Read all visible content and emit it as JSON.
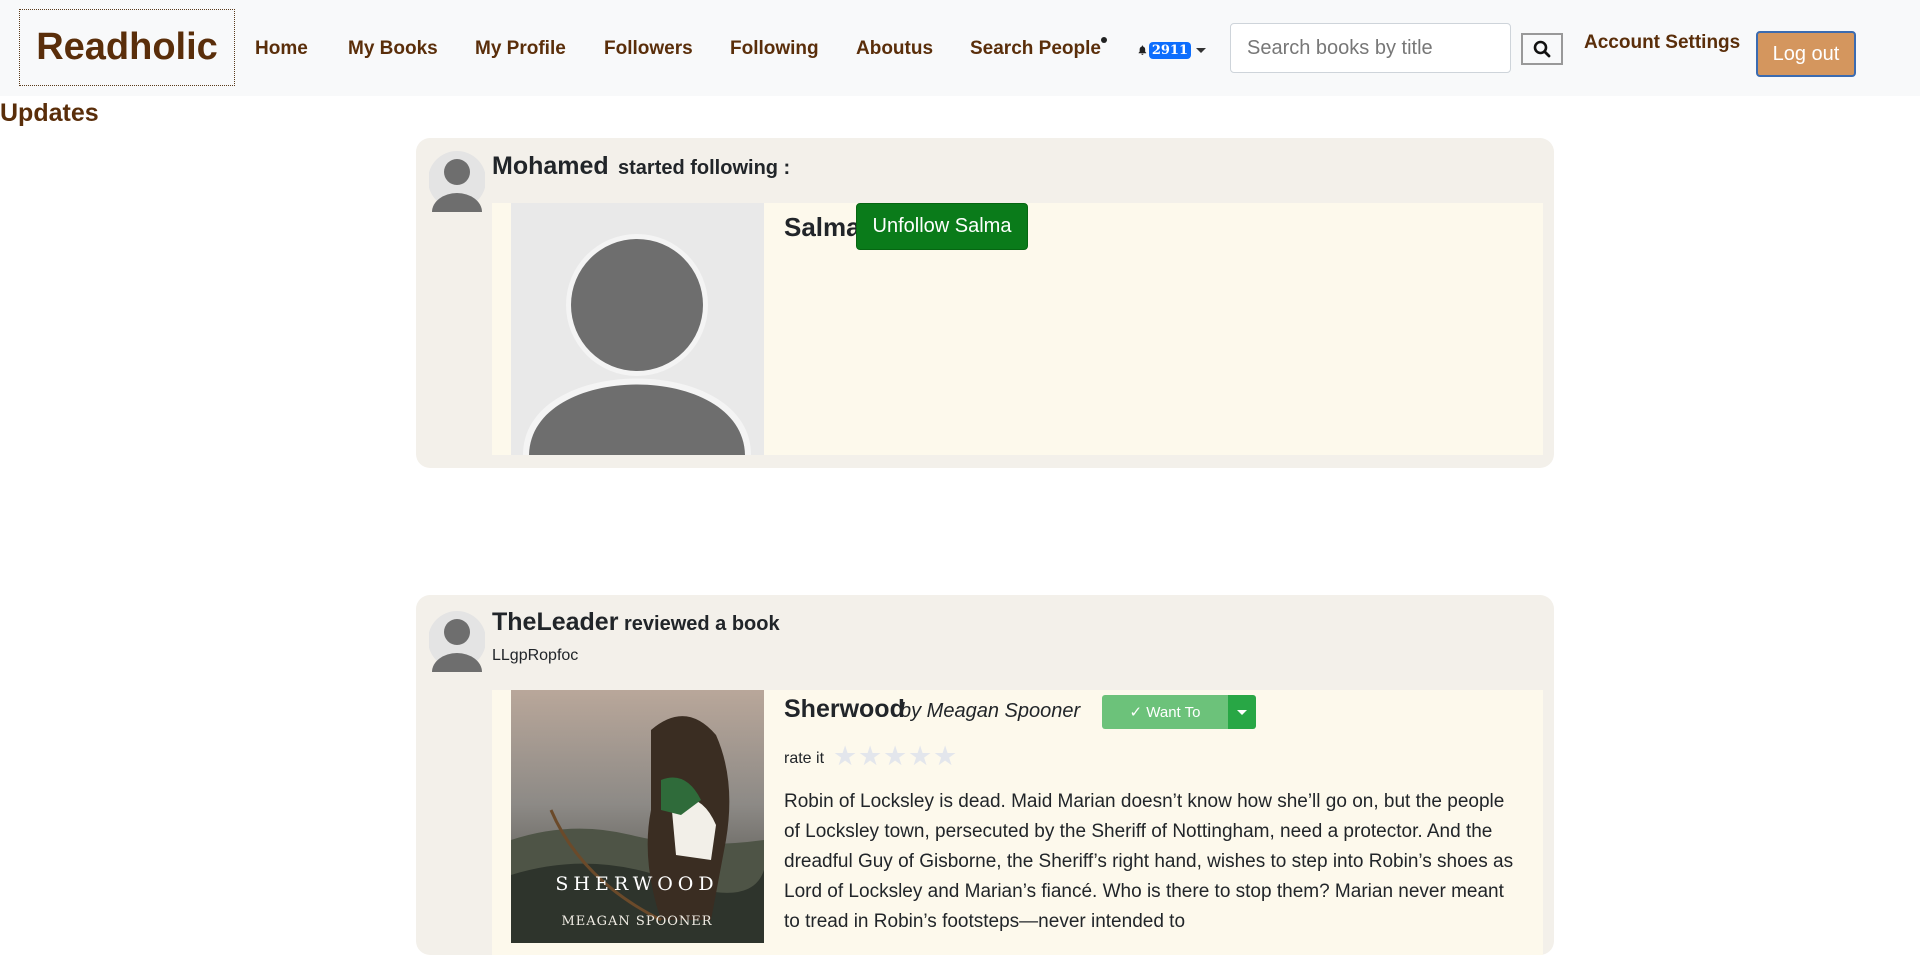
{
  "navbar": {
    "brand": "Readholic",
    "links": [
      "Home",
      "My Books",
      "My Profile",
      "Followers",
      "Following",
      "Aboutus",
      "Search People"
    ],
    "notification_count": "2911",
    "search_placeholder": "Search books by title",
    "account_settings": "Account Settings",
    "logout": "Log out"
  },
  "page": {
    "heading": "Updates"
  },
  "updates": [
    {
      "user": "Mohamed",
      "action": "started following :",
      "target_name": "Salma",
      "button_label": "Unfollow Salma"
    },
    {
      "user": "TheLeader",
      "action": "reviewed a book",
      "review_text": "LLgpRopfoc",
      "book_title": "Sherwood",
      "book_author": "by Meagan Spooner",
      "cover_title": "SHERWOOD",
      "cover_author": "MEAGAN SPOONER",
      "shelf_button": "✓ Want To",
      "rate_label": "rate it",
      "rating": 0,
      "description": "Robin of Locksley is dead. Maid Marian doesn’t know how she’ll go on, but the people of Locksley town, persecuted by the Sheriff of Nottingham, need a protector. And the dreadful Guy of Gisborne, the Sheriff’s right hand, wishes to step into Robin’s shoes as Lord of Locksley and Marian’s fiancé. Who is there to stop them? Marian never meant to tread in Robin’s footsteps—never intended to"
    }
  ],
  "colors": {
    "brand": "#5a2e0a",
    "logout_bg": "#d4965e",
    "unfollow_bg": "#0a7b1a",
    "badge": "#0d6efd",
    "want_btn": "#6cc27a"
  }
}
